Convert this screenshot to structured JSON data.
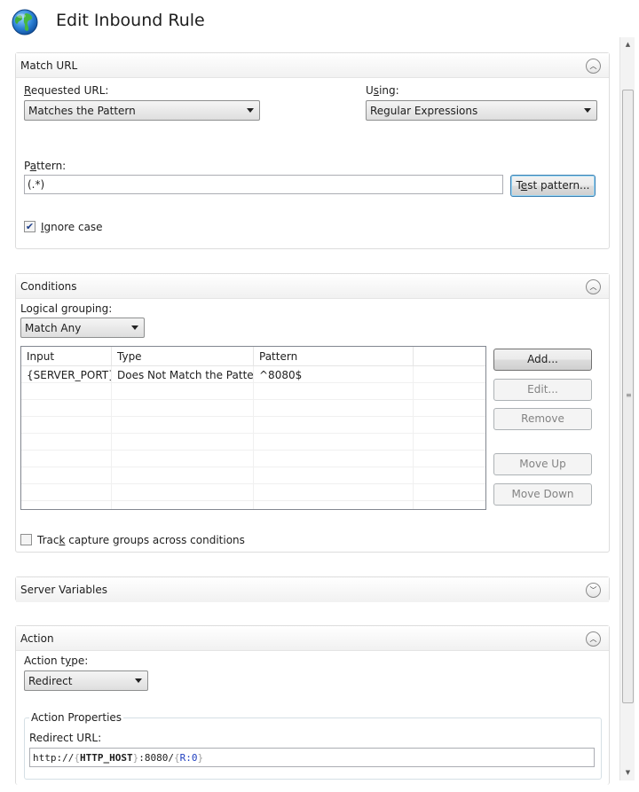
{
  "header": {
    "title": "Edit Inbound Rule",
    "icon": "globe-icon"
  },
  "match_url": {
    "title": "Match URL",
    "requested_url": {
      "label_u": "R",
      "label_rest": "equested URL:",
      "value": "Matches the Pattern"
    },
    "using": {
      "label_pre": "U",
      "label_u": "s",
      "label_rest": "ing:",
      "value": "Regular Expressions"
    },
    "pattern": {
      "label_pre": "P",
      "label_u": "a",
      "label_rest": "ttern:",
      "value": "(.*)"
    },
    "test_button": {
      "pre": "T",
      "u": "e",
      "rest": "st pattern..."
    },
    "ignore_case": {
      "u": "I",
      "rest": "gnore case",
      "checked": true
    }
  },
  "conditions": {
    "title": "Conditions",
    "logical_grouping_label": "Logical grouping:",
    "logical_grouping_value": "Match Any",
    "columns": [
      "Input",
      "Type",
      "Pattern"
    ],
    "rows": [
      {
        "input": "{SERVER_PORT}",
        "type": "Does Not Match the Pattern",
        "pattern": "^8080$"
      }
    ],
    "buttons": {
      "add": "Add...",
      "edit": "Edit...",
      "remove": "Remove",
      "move_up": "Move Up",
      "move_down": "Move Down"
    },
    "track": {
      "pre": "Trac",
      "u": "k",
      "rest": " capture groups across conditions",
      "checked": false
    }
  },
  "server_variables": {
    "title": "Server Variables"
  },
  "action": {
    "title": "Action",
    "action_type": {
      "label_pre": "Action t",
      "label_u": "y",
      "label_rest": "pe:",
      "value": "Redirect"
    },
    "properties_title": "Action Properties",
    "redirect_url_label": "Redirect URL:",
    "redirect_url": {
      "prefix": "http://",
      "open1": "{",
      "var1": "HTTP_HOST",
      "close1": "}",
      "middle": ":8080/",
      "open2": "{",
      "var2": "R:0",
      "close2": "}"
    }
  }
}
